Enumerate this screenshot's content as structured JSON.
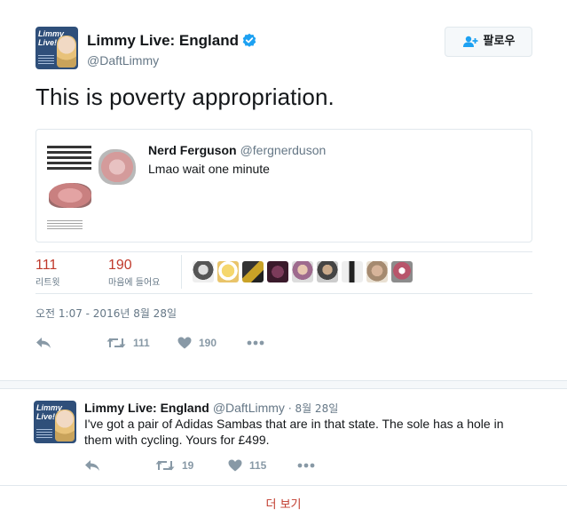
{
  "colors": {
    "accent": "#c0392b",
    "muted": "#657786",
    "icon": "#8899a6",
    "border": "#e1e8ed",
    "verified": "#1da1f2"
  },
  "tweet": {
    "author_name": "Limmy Live: England",
    "author_handle": "@DaftLimmy",
    "avatar_text": "Limmy Live!",
    "verified_icon": "verified-badge-icon",
    "follow_label": "팔로우",
    "follow_icon": "add-user-icon",
    "text": "This is poverty appropriation.",
    "quote": {
      "name": "Nerd Ferguson",
      "handle": "@fergnerduson",
      "text": "Lmao wait one minute",
      "media": "shoe-image"
    },
    "retweets_count": "111",
    "retweets_label": "리트윗",
    "likes_count": "190",
    "likes_label": "마음에 들어요",
    "liker_avatar_count": 9,
    "timestamp": "오전 1:07 - 2016년 8월 28일",
    "actions": {
      "reply_icon": "reply-icon",
      "retweet_icon": "retweet-icon",
      "retweet_count": "111",
      "like_icon": "heart-icon",
      "like_count": "190",
      "more_icon": "more-dots-icon"
    }
  },
  "reply": {
    "author_name": "Limmy Live: England",
    "author_handle": "@DaftLimmy",
    "date": "· 8월 28일",
    "avatar_text": "Limmy Live!",
    "text": "I've got a pair of Adidas Sambas that are in that state. The sole has a hole in them with cycling. Yours for £499.",
    "actions": {
      "retweet_count": "19",
      "like_count": "115"
    }
  },
  "more_link": "더 보기"
}
